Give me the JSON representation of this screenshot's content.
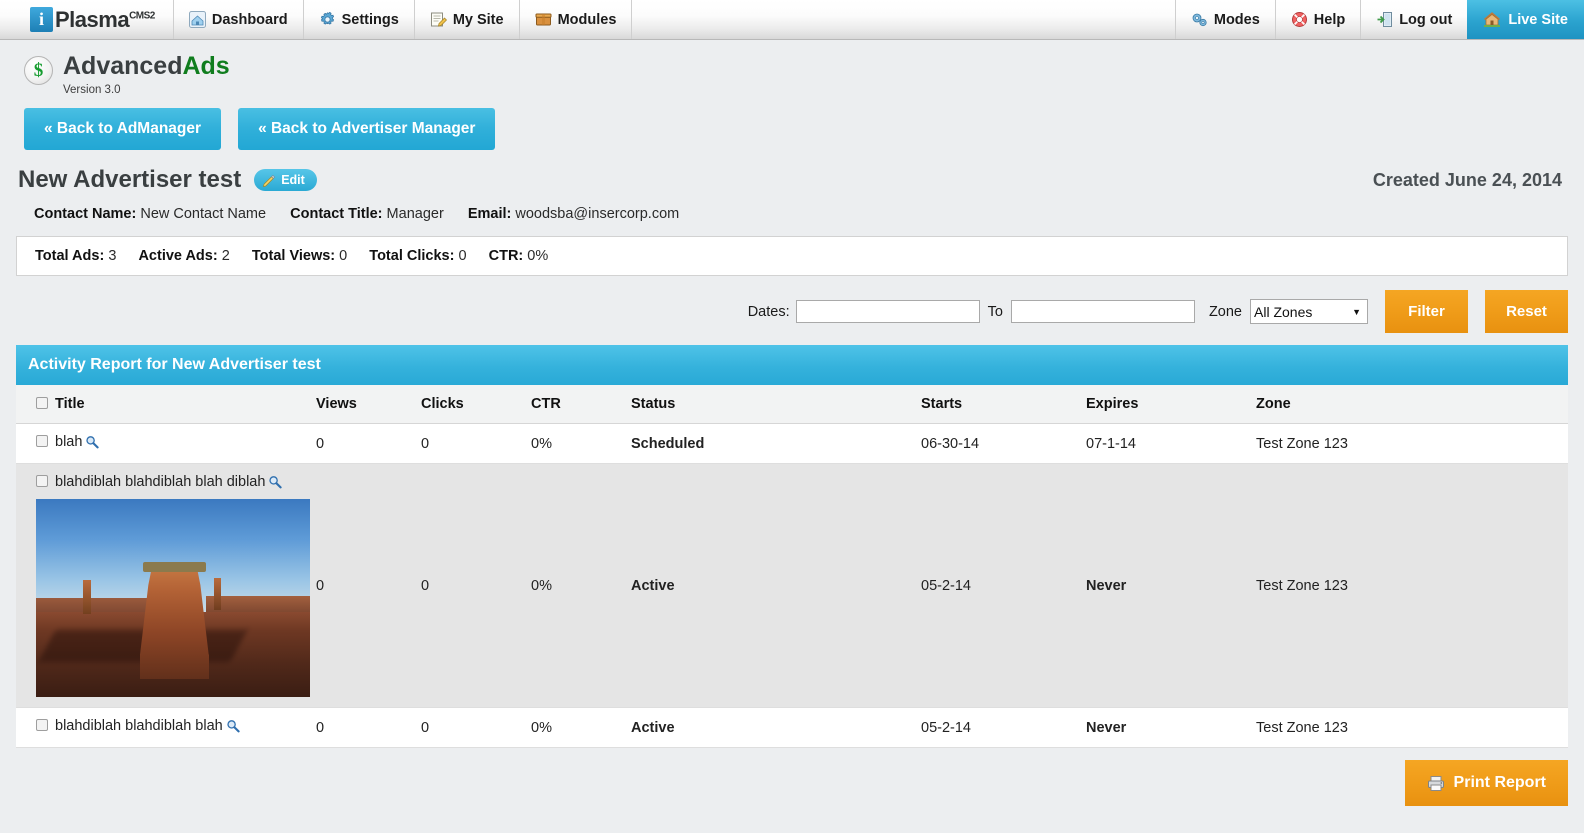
{
  "topnav": {
    "brand": {
      "name": "Plasma",
      "sup": "CMS2",
      "logo_icon": "info-logo-icon"
    },
    "items": [
      {
        "label": "Dashboard",
        "icon": "dashboard-icon"
      },
      {
        "label": "Settings",
        "icon": "gear-icon"
      },
      {
        "label": "My Site",
        "icon": "pencil-note-icon"
      },
      {
        "label": "Modules",
        "icon": "box-icon"
      }
    ],
    "right_items": [
      {
        "label": "Modes",
        "icon": "gears-icon"
      },
      {
        "label": "Help",
        "icon": "lifering-icon"
      },
      {
        "label": "Log out",
        "icon": "exit-door-icon"
      }
    ],
    "live_site": {
      "label": "Live Site",
      "icon": "home-icon"
    }
  },
  "module": {
    "title_first": "Advanced",
    "title_second": "Ads",
    "badge_icon": "dollar-icon",
    "version": "Version 3.0",
    "back_admanager": "« Back to AdManager",
    "back_advertiser": "« Back to Advertiser Manager"
  },
  "advertiser": {
    "name": "New Advertiser test",
    "edit_label": "Edit",
    "edit_icon": "pencil-icon",
    "created": "Created June 24, 2014",
    "contact_name_label": "Contact Name:",
    "contact_name": "New Contact Name",
    "contact_title_label": "Contact Title:",
    "contact_title": "Manager",
    "email_label": "Email:",
    "email": "woodsba@insercorp.com"
  },
  "stats": {
    "total_ads_label": "Total Ads:",
    "total_ads": "3",
    "active_ads_label": "Active Ads:",
    "active_ads": "2",
    "total_views_label": "Total Views:",
    "total_views": "0",
    "total_clicks_label": "Total Clicks:",
    "total_clicks": "0",
    "ctr_label": "CTR:",
    "ctr": "0%"
  },
  "filter": {
    "dates_label": "Dates:",
    "date_from": "",
    "date_to": "",
    "to_label": "To",
    "zone_label": "Zone",
    "zone_value": "All Zones",
    "zone_options": [
      "All Zones"
    ],
    "filter_button": "Filter",
    "reset_button": "Reset"
  },
  "report": {
    "heading": "Activity Report for New Advertiser test",
    "columns": [
      "Title",
      "Views",
      "Clicks",
      "CTR",
      "Status",
      "Starts",
      "Expires",
      "Zone"
    ],
    "rows": [
      {
        "title": "blah",
        "views": "0",
        "clicks": "0",
        "ctr": "0%",
        "status": "Scheduled",
        "status_color": "#f5a623",
        "starts": "06-30-14",
        "expires": "07-1-14",
        "zone": "Test Zone 123",
        "has_image": false
      },
      {
        "title": "blahdiblah blahdiblah blah diblah",
        "views": "0",
        "clicks": "0",
        "ctr": "0%",
        "status": "Active",
        "status_color": "#0f8a1e",
        "starts": "05-2-14",
        "expires": "Never",
        "zone": "Test Zone 123",
        "has_image": true,
        "image_alt": "desert-butte-photo"
      },
      {
        "title": "blahdiblah blahdiblah blah",
        "views": "0",
        "clicks": "0",
        "ctr": "0%",
        "status": "Active",
        "status_color": "#0f8a1e",
        "starts": "05-2-14",
        "expires": "Never",
        "zone": "Test Zone 123",
        "has_image": false
      }
    ],
    "print_button": "Print Report",
    "print_icon": "printer-icon"
  },
  "colors": {
    "accent_blue": "#2ba9d6",
    "accent_orange": "#f0990f",
    "status_active": "#0f8a1e",
    "status_scheduled": "#f5a623"
  }
}
